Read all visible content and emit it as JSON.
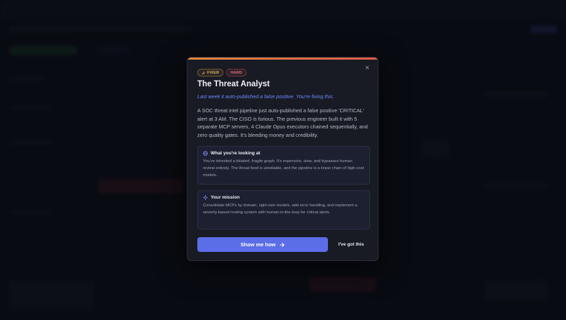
{
  "modal": {
    "close_glyph": "×",
    "badges": [
      {
        "label": "FIXER",
        "icon": "wrench-icon",
        "color": "#e0b060"
      },
      {
        "label": "HARD",
        "color": "#e07070"
      }
    ],
    "title": "The Threat Analyst",
    "subtitle": "Last week it auto-published a false positive. You're fixing this.",
    "description": "A SOC threat intel pipeline just auto-published a false positive 'CRITICAL' alert at 3 AM. The CISO is furious. The previous engineer built it with 5 separate MCP servers, 4 Claude Opus executors chained sequentially, and zero quality gates. It's bleeding money and credibility.",
    "looking_card": {
      "icon": "globe-icon",
      "heading": "What you're looking at",
      "body": "You've inherited a bloated, fragile graph. It's expensive, slow, and bypasses human review entirely. The threat feed is unreliable, and the pipeline is a linear chain of high-cost models."
    },
    "mission_card": {
      "icon": "sparkle-icon",
      "heading": "Your mission",
      "body": "Consolidate MCPs by domain, right-size models, add error handling, and implement a severity-based routing system with human-in-the-loop for critical alerts."
    },
    "primary_button": {
      "label": "Show me how",
      "icon": "arrow-right-icon"
    },
    "secondary_button": {
      "label": "I've got this"
    }
  },
  "colors": {
    "accent": "#5b6ee8",
    "subtitle": "#6b8cff",
    "top_gradient_start": "#e08a3c",
    "top_gradient_end": "#e05a4a"
  }
}
